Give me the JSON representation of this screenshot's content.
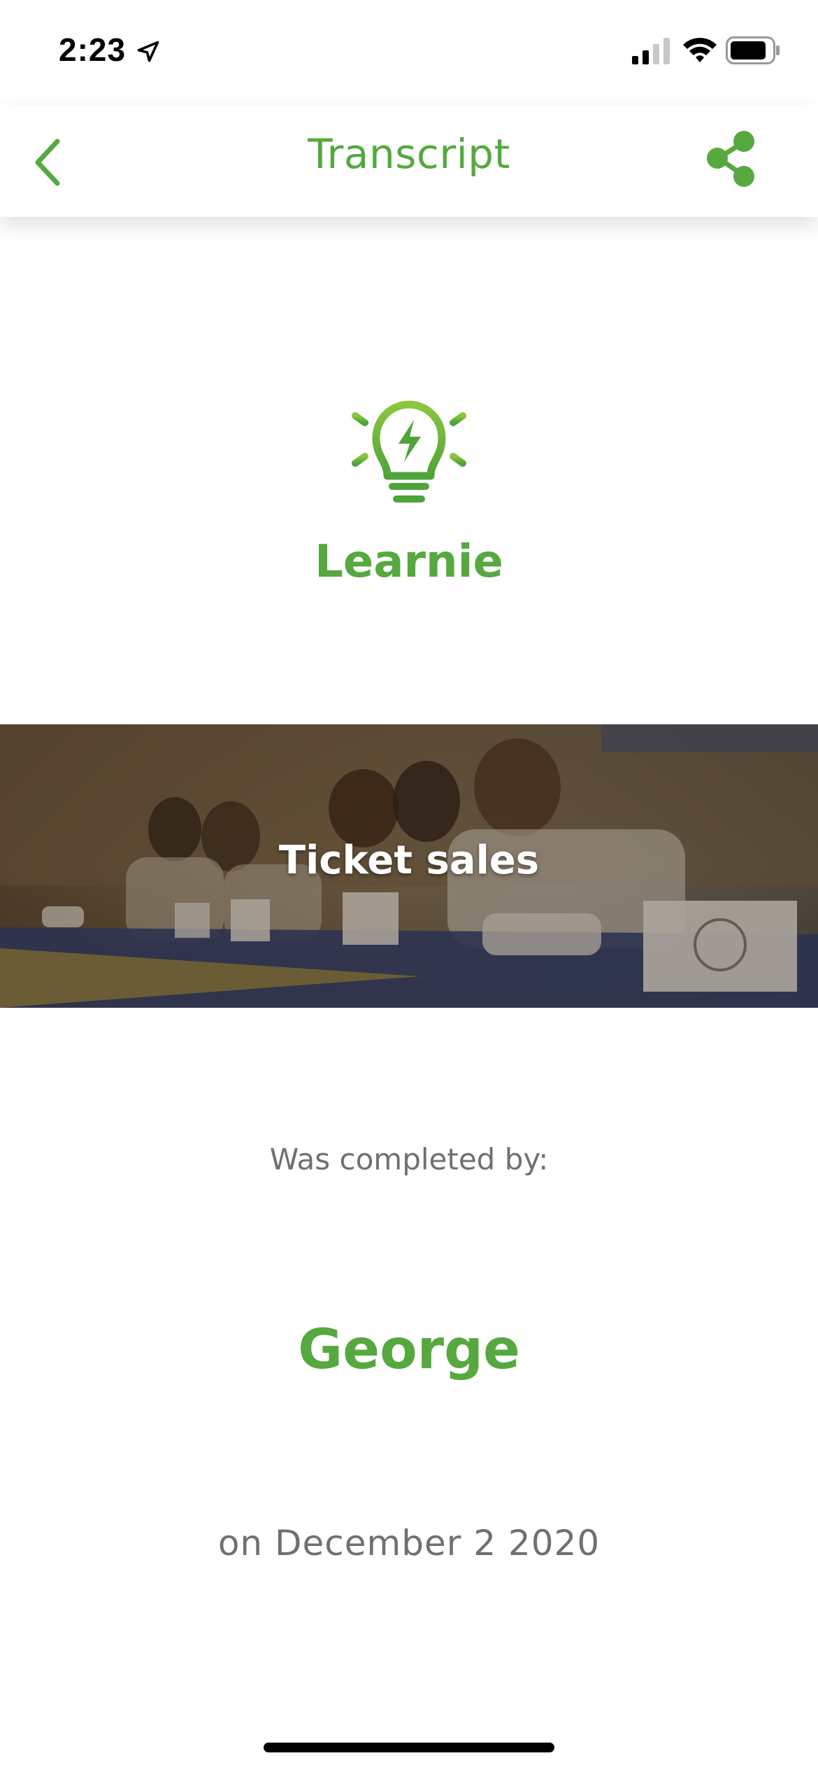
{
  "status_bar": {
    "time": "2:23",
    "icons": [
      "location-arrow-icon",
      "cellular-signal-icon",
      "wifi-icon",
      "battery-icon"
    ]
  },
  "nav": {
    "title": "Transcript",
    "back_icon": "chevron-left-icon",
    "share_icon": "share-icon"
  },
  "brand": {
    "logo_icon": "lightbulb-icon",
    "name": "Learnie"
  },
  "course": {
    "title": "Ticket sales"
  },
  "completion": {
    "label": "Was completed by:",
    "user": "George",
    "date": "on December 2 2020"
  },
  "colors": {
    "accent": "#55a93e",
    "muted_text": "#707070",
    "background": "#ffffff"
  }
}
